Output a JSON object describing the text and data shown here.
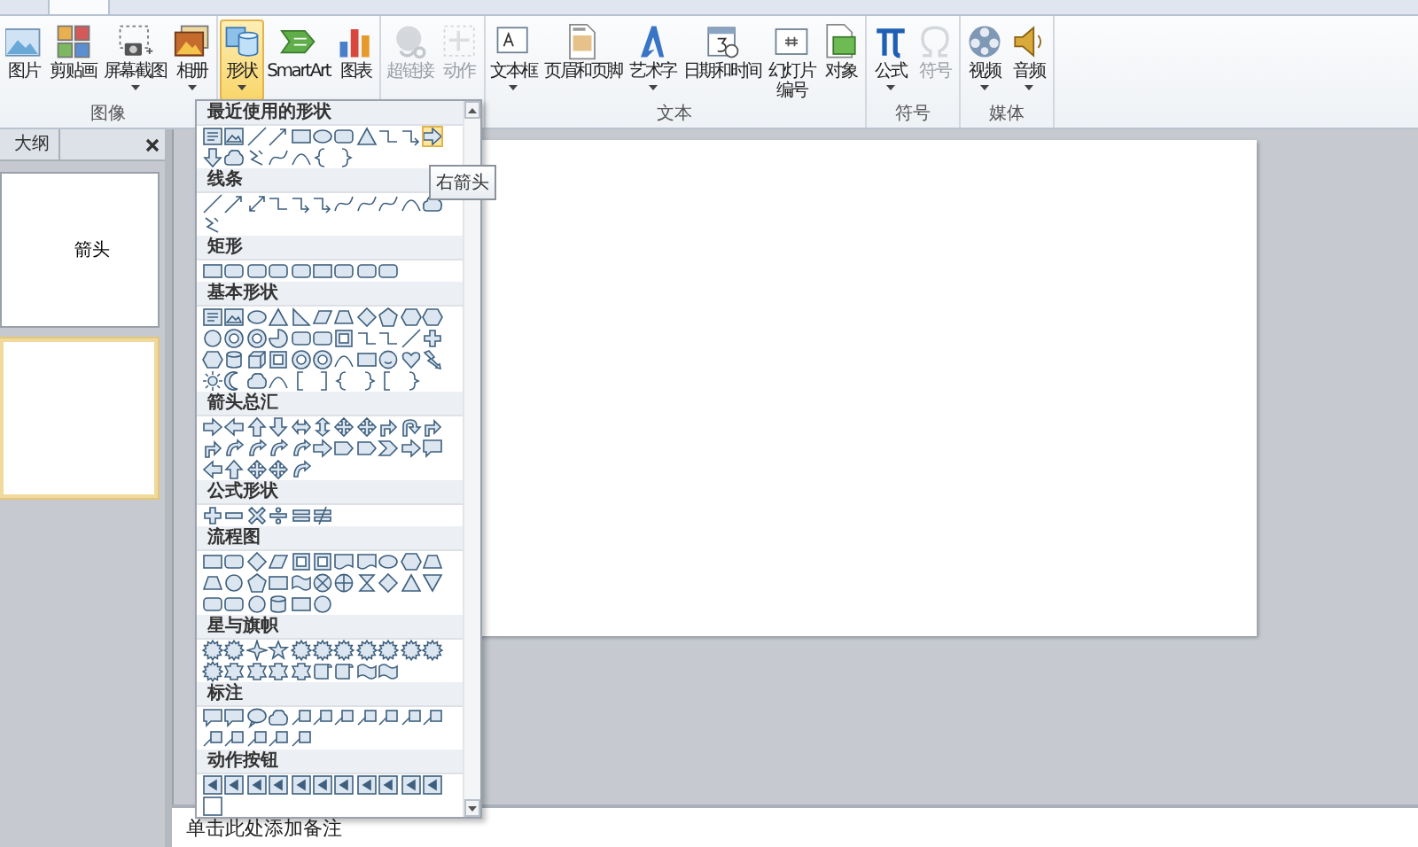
{
  "ribbon": {
    "groups": [
      {
        "label": "图像",
        "buttons": [
          {
            "label": "图片",
            "dropdown": false,
            "disabled": false,
            "pressed": false
          },
          {
            "label": "剪贴画",
            "dropdown": false,
            "disabled": false,
            "pressed": false
          },
          {
            "label": "屏幕截图",
            "dropdown": true,
            "disabled": false,
            "pressed": false
          },
          {
            "label": "相册",
            "dropdown": true,
            "disabled": false,
            "pressed": false
          }
        ]
      },
      {
        "buttons": [
          {
            "label": "形状",
            "dropdown": true,
            "disabled": false,
            "pressed": true
          },
          {
            "label": "SmartArt",
            "dropdown": false,
            "disabled": false,
            "pressed": false
          },
          {
            "label": "图表",
            "dropdown": false,
            "disabled": false,
            "pressed": false
          }
        ]
      },
      {
        "buttons": [
          {
            "label": "超链接",
            "dropdown": false,
            "disabled": true,
            "pressed": false
          },
          {
            "label": "动作",
            "dropdown": false,
            "disabled": true,
            "pressed": false
          }
        ]
      },
      {
        "label": "文本",
        "buttons": [
          {
            "label": "文本框",
            "dropdown": true,
            "disabled": false,
            "pressed": false
          },
          {
            "label": "页眉和页脚",
            "dropdown": false,
            "disabled": false,
            "pressed": false
          },
          {
            "label": "艺术字",
            "dropdown": true,
            "disabled": false,
            "pressed": false
          },
          {
            "label": "日期和时间",
            "dropdown": false,
            "disabled": false,
            "pressed": false
          },
          {
            "lines": [
              "幻灯片",
              "编号"
            ],
            "dropdown": false,
            "disabled": false,
            "pressed": false
          },
          {
            "label": "对象",
            "dropdown": false,
            "disabled": false,
            "pressed": false
          }
        ]
      },
      {
        "label": "符号",
        "buttons": [
          {
            "label": "公式",
            "dropdown": true,
            "disabled": false,
            "pressed": false
          },
          {
            "label": "符号",
            "dropdown": false,
            "disabled": true,
            "pressed": false
          }
        ]
      },
      {
        "label": "媒体",
        "buttons": [
          {
            "label": "视频",
            "dropdown": true,
            "disabled": false,
            "pressed": false
          },
          {
            "label": "音频",
            "dropdown": true,
            "disabled": false,
            "pressed": false
          }
        ]
      }
    ]
  },
  "outline_pane": {
    "tab": "大纲",
    "slides": [
      {
        "title": "箭头",
        "selected": false
      },
      {
        "selected": true
      }
    ]
  },
  "notes": {
    "placeholder": "单击此处添加备注"
  },
  "shapes_gallery": {
    "sections": [
      {
        "title": "最近使用的形状",
        "items": [
          {
            "kind": "textbox",
            "selected": false
          },
          {
            "kind": "picture-box",
            "selected": false
          },
          {
            "kind": "line",
            "selected": false
          },
          {
            "kind": "arrow-line",
            "selected": false
          },
          {
            "kind": "rectangle",
            "selected": false
          },
          {
            "kind": "oval",
            "selected": false
          },
          {
            "kind": "rounded-rectangle",
            "selected": false
          },
          {
            "kind": "triangle",
            "selected": false
          },
          {
            "kind": "elbow",
            "selected": false
          },
          {
            "kind": "elbow-arrow",
            "selected": false
          },
          {
            "kind": "right-arrow",
            "selected": true
          },
          {
            "kind": "down-arrow",
            "selected": false
          },
          {
            "kind": "cloud",
            "selected": false
          },
          {
            "kind": "scribble",
            "selected": false
          },
          {
            "kind": "curve",
            "selected": false
          },
          {
            "kind": "arc",
            "selected": false
          },
          {
            "kind": "left-brace",
            "selected": false
          },
          {
            "kind": "right-brace",
            "selected": false
          }
        ]
      },
      {
        "title": "线条",
        "items": [
          {
            "kind": "line"
          },
          {
            "kind": "arrow-line"
          },
          {
            "kind": "double-arrow-line"
          },
          {
            "kind": "elbow"
          },
          {
            "kind": "elbow-arrow"
          },
          {
            "kind": "elbow-arrow"
          },
          {
            "kind": "curve"
          },
          {
            "kind": "curve"
          },
          {
            "kind": "curve"
          },
          {
            "kind": "arc"
          },
          {
            "kind": "cloud"
          },
          {
            "kind": "scribble"
          }
        ]
      },
      {
        "title": "矩形",
        "items": [
          {
            "kind": "rectangle"
          },
          {
            "kind": "rounded-rectangle"
          },
          {
            "kind": "rounded-rectangle"
          },
          {
            "kind": "rounded-rectangle"
          },
          {
            "kind": "rounded-rectangle"
          },
          {
            "kind": "rectangle"
          },
          {
            "kind": "rounded-rectangle"
          },
          {
            "kind": "rounded-rectangle"
          },
          {
            "kind": "rounded-rectangle"
          }
        ]
      },
      {
        "title": "基本形状",
        "items": [
          {
            "kind": "textbox"
          },
          {
            "kind": "picture-box"
          },
          {
            "kind": "oval"
          },
          {
            "kind": "triangle"
          },
          {
            "kind": "right-triangle"
          },
          {
            "kind": "parallelogram"
          },
          {
            "kind": "trapezoid"
          },
          {
            "kind": "diamond"
          },
          {
            "kind": "pentagon"
          },
          {
            "kind": "hexagon"
          },
          {
            "kind": "hexagon"
          },
          {
            "kind": "circle"
          },
          {
            "kind": "donut"
          },
          {
            "kind": "donut"
          },
          {
            "kind": "pie"
          },
          {
            "kind": "rounded-rectangle"
          },
          {
            "kind": "rounded-rectangle"
          },
          {
            "kind": "frame"
          },
          {
            "kind": "elbow"
          },
          {
            "kind": "elbow"
          },
          {
            "kind": "line"
          },
          {
            "kind": "plus"
          },
          {
            "kind": "hexagon"
          },
          {
            "kind": "cylinder"
          },
          {
            "kind": "cube"
          },
          {
            "kind": "frame"
          },
          {
            "kind": "donut"
          },
          {
            "kind": "donut"
          },
          {
            "kind": "arc"
          },
          {
            "kind": "rectangle"
          },
          {
            "kind": "smiley"
          },
          {
            "kind": "heart"
          },
          {
            "kind": "lightning"
          },
          {
            "kind": "sun"
          },
          {
            "kind": "moon"
          },
          {
            "kind": "cloud"
          },
          {
            "kind": "arc"
          },
          {
            "kind": "left-bracket"
          },
          {
            "kind": "right-bracket"
          },
          {
            "kind": "left-brace"
          },
          {
            "kind": "right-brace"
          },
          {
            "kind": "left-bracket"
          },
          {
            "kind": "right-brace"
          }
        ]
      },
      {
        "title": "箭头总汇",
        "items": [
          {
            "kind": "right-arrow"
          },
          {
            "kind": "left-arrow"
          },
          {
            "kind": "up-arrow"
          },
          {
            "kind": "down-arrow"
          },
          {
            "kind": "left-right-arrow"
          },
          {
            "kind": "up-down-arrow"
          },
          {
            "kind": "four-way-arrow"
          },
          {
            "kind": "four-way-arrow"
          },
          {
            "kind": "bent-arrow"
          },
          {
            "kind": "u-turn-arrow"
          },
          {
            "kind": "bent-arrow"
          },
          {
            "kind": "bent-arrow"
          },
          {
            "kind": "curved-arrow"
          },
          {
            "kind": "curved-arrow"
          },
          {
            "kind": "curved-arrow"
          },
          {
            "kind": "curved-arrow"
          },
          {
            "kind": "right-arrow"
          },
          {
            "kind": "pentagon-arrow"
          },
          {
            "kind": "pentagon-arrow"
          },
          {
            "kind": "chevron"
          },
          {
            "kind": "right-arrow"
          },
          {
            "kind": "callout"
          },
          {
            "kind": "left-arrow"
          },
          {
            "kind": "up-arrow"
          },
          {
            "kind": "four-way-arrow"
          },
          {
            "kind": "four-way-arrow"
          },
          {
            "kind": "curved-arrow"
          }
        ]
      },
      {
        "title": "公式形状",
        "items": [
          {
            "kind": "plus"
          },
          {
            "kind": "minus"
          },
          {
            "kind": "multiply"
          },
          {
            "kind": "divide"
          },
          {
            "kind": "equal"
          },
          {
            "kind": "not-equal"
          }
        ]
      },
      {
        "title": "流程图",
        "items": [
          {
            "kind": "rectangle"
          },
          {
            "kind": "rounded-rectangle"
          },
          {
            "kind": "diamond"
          },
          {
            "kind": "parallelogram"
          },
          {
            "kind": "frame"
          },
          {
            "kind": "frame"
          },
          {
            "kind": "document"
          },
          {
            "kind": "document"
          },
          {
            "kind": "oval"
          },
          {
            "kind": "hexagon"
          },
          {
            "kind": "trapezoid"
          },
          {
            "kind": "trapezoid"
          },
          {
            "kind": "circle"
          },
          {
            "kind": "pentagon"
          },
          {
            "kind": "rectangle"
          },
          {
            "kind": "wave"
          },
          {
            "kind": "circle-cross"
          },
          {
            "kind": "circle-plus"
          },
          {
            "kind": "hourglass"
          },
          {
            "kind": "diamond"
          },
          {
            "kind": "triangle"
          },
          {
            "kind": "down-triangle"
          },
          {
            "kind": "rounded-rectangle"
          },
          {
            "kind": "rounded-rectangle"
          },
          {
            "kind": "circle"
          },
          {
            "kind": "cylinder"
          },
          {
            "kind": "rectangle"
          },
          {
            "kind": "circle"
          }
        ]
      },
      {
        "title": "星与旗帜",
        "items": [
          {
            "kind": "burst"
          },
          {
            "kind": "burst"
          },
          {
            "kind": "four-point-star"
          },
          {
            "kind": "star"
          },
          {
            "kind": "burst"
          },
          {
            "kind": "burst"
          },
          {
            "kind": "burst"
          },
          {
            "kind": "burst"
          },
          {
            "kind": "burst"
          },
          {
            "kind": "burst"
          },
          {
            "kind": "burst"
          },
          {
            "kind": "burst"
          },
          {
            "kind": "ribbon"
          },
          {
            "kind": "ribbon"
          },
          {
            "kind": "ribbon"
          },
          {
            "kind": "ribbon"
          },
          {
            "kind": "scroll"
          },
          {
            "kind": "scroll"
          },
          {
            "kind": "wave"
          },
          {
            "kind": "wave"
          }
        ]
      },
      {
        "title": "标注",
        "items": [
          {
            "kind": "callout"
          },
          {
            "kind": "callout"
          },
          {
            "kind": "oval-callout"
          },
          {
            "kind": "cloud"
          },
          {
            "kind": "line-callout"
          },
          {
            "kind": "line-callout"
          },
          {
            "kind": "line-callout"
          },
          {
            "kind": "line-callout"
          },
          {
            "kind": "line-callout"
          },
          {
            "kind": "line-callout"
          },
          {
            "kind": "line-callout"
          },
          {
            "kind": "line-callout"
          },
          {
            "kind": "line-callout"
          },
          {
            "kind": "line-callout"
          },
          {
            "kind": "line-callout"
          },
          {
            "kind": "line-callout"
          }
        ]
      },
      {
        "title": "动作按钮",
        "items": [
          {
            "kind": "action-button"
          },
          {
            "kind": "action-button"
          },
          {
            "kind": "action-button"
          },
          {
            "kind": "action-button"
          },
          {
            "kind": "action-button"
          },
          {
            "kind": "action-button"
          },
          {
            "kind": "action-button"
          },
          {
            "kind": "action-button"
          },
          {
            "kind": "action-button"
          },
          {
            "kind": "action-button"
          },
          {
            "kind": "action-button"
          },
          {
            "kind": "blank-square"
          }
        ]
      }
    ]
  },
  "tooltip": "右箭头"
}
